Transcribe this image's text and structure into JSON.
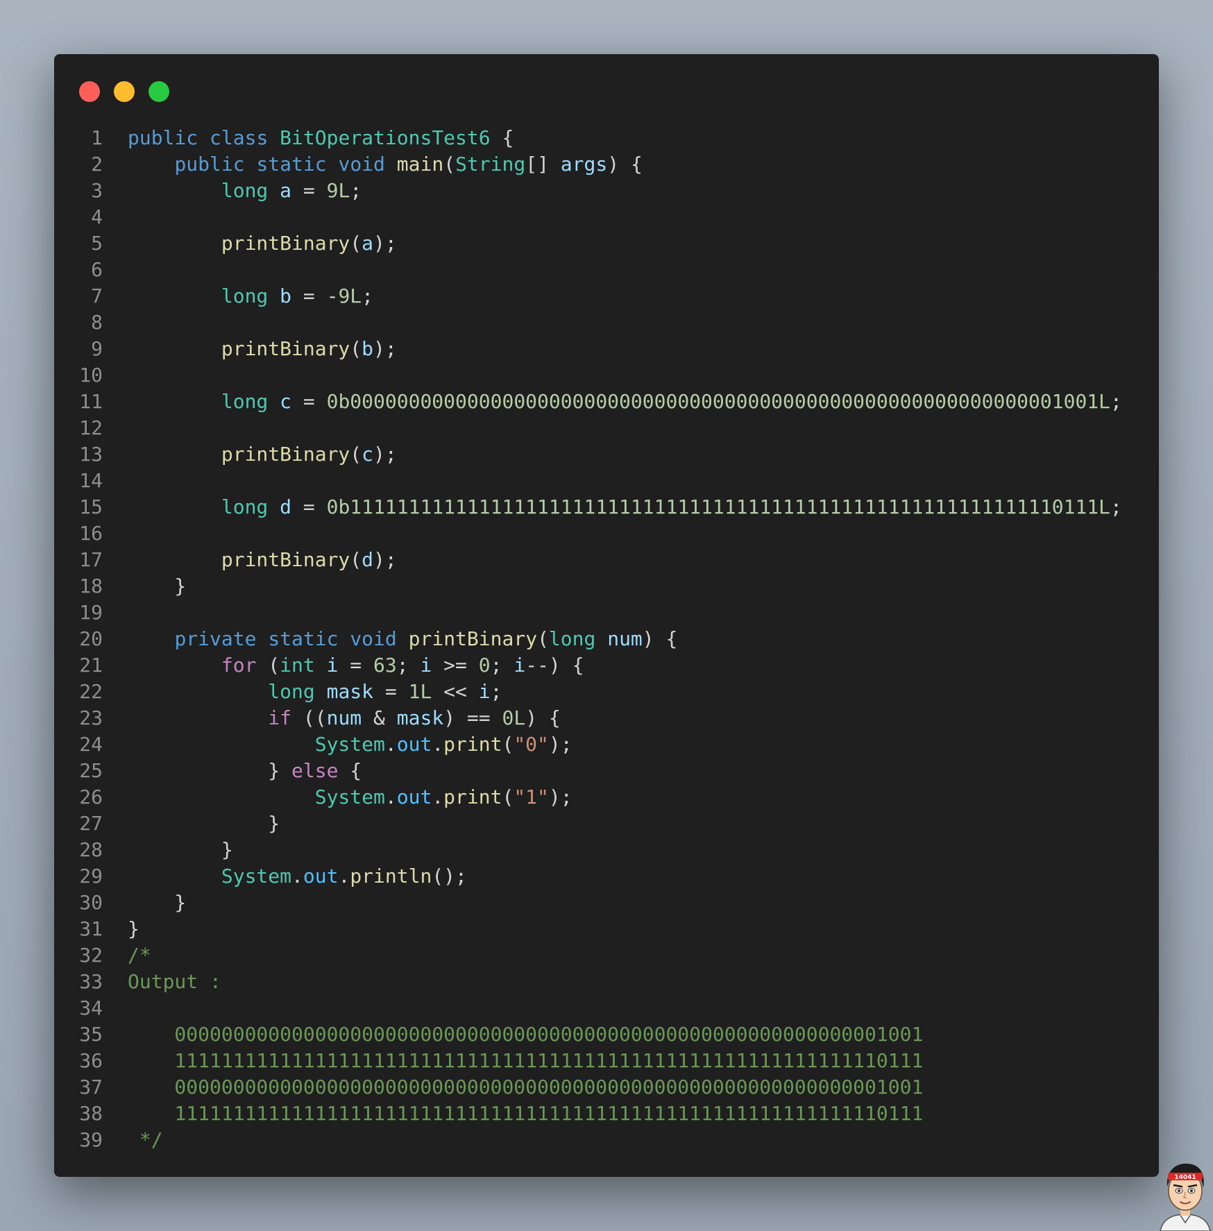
{
  "window": {
    "controls": [
      "close",
      "minimize",
      "maximize"
    ],
    "language": "java"
  },
  "code_lines": [
    {
      "n": "1",
      "tokens": [
        [
          "kw",
          "public"
        ],
        [
          "p",
          " "
        ],
        [
          "kw",
          "class"
        ],
        [
          "p",
          " "
        ],
        [
          "ty",
          "BitOperationsTest6"
        ],
        [
          "p",
          " {"
        ]
      ]
    },
    {
      "n": "2",
      "tokens": [
        [
          "p",
          "    "
        ],
        [
          "kw",
          "public"
        ],
        [
          "p",
          " "
        ],
        [
          "kw",
          "static"
        ],
        [
          "p",
          " "
        ],
        [
          "kw",
          "void"
        ],
        [
          "p",
          " "
        ],
        [
          "fn",
          "main"
        ],
        [
          "p",
          "("
        ],
        [
          "ty",
          "String"
        ],
        [
          "p",
          "[] "
        ],
        [
          "var",
          "args"
        ],
        [
          "p",
          ") {"
        ]
      ]
    },
    {
      "n": "3",
      "tokens": [
        [
          "p",
          "        "
        ],
        [
          "ty",
          "long"
        ],
        [
          "p",
          " "
        ],
        [
          "var",
          "a"
        ],
        [
          "p",
          " = "
        ],
        [
          "num",
          "9L"
        ],
        [
          "p",
          ";"
        ]
      ]
    },
    {
      "n": "4",
      "tokens": []
    },
    {
      "n": "5",
      "tokens": [
        [
          "p",
          "        "
        ],
        [
          "fn",
          "printBinary"
        ],
        [
          "p",
          "("
        ],
        [
          "var",
          "a"
        ],
        [
          "p",
          ");"
        ]
      ]
    },
    {
      "n": "6",
      "tokens": []
    },
    {
      "n": "7",
      "tokens": [
        [
          "p",
          "        "
        ],
        [
          "ty",
          "long"
        ],
        [
          "p",
          " "
        ],
        [
          "var",
          "b"
        ],
        [
          "p",
          " = -"
        ],
        [
          "num",
          "9L"
        ],
        [
          "p",
          ";"
        ]
      ]
    },
    {
      "n": "8",
      "tokens": []
    },
    {
      "n": "9",
      "tokens": [
        [
          "p",
          "        "
        ],
        [
          "fn",
          "printBinary"
        ],
        [
          "p",
          "("
        ],
        [
          "var",
          "b"
        ],
        [
          "p",
          ");"
        ]
      ]
    },
    {
      "n": "10",
      "tokens": []
    },
    {
      "n": "11",
      "tokens": [
        [
          "p",
          "        "
        ],
        [
          "ty",
          "long"
        ],
        [
          "p",
          " "
        ],
        [
          "var",
          "c"
        ],
        [
          "p",
          " = "
        ],
        [
          "num",
          "0b0000000000000000000000000000000000000000000000000000000000001001L"
        ],
        [
          "p",
          ";"
        ]
      ]
    },
    {
      "n": "12",
      "tokens": []
    },
    {
      "n": "13",
      "tokens": [
        [
          "p",
          "        "
        ],
        [
          "fn",
          "printBinary"
        ],
        [
          "p",
          "("
        ],
        [
          "var",
          "c"
        ],
        [
          "p",
          ");"
        ]
      ]
    },
    {
      "n": "14",
      "tokens": []
    },
    {
      "n": "15",
      "tokens": [
        [
          "p",
          "        "
        ],
        [
          "ty",
          "long"
        ],
        [
          "p",
          " "
        ],
        [
          "var",
          "d"
        ],
        [
          "p",
          " = "
        ],
        [
          "num",
          "0b1111111111111111111111111111111111111111111111111111111111110111L"
        ],
        [
          "p",
          ";"
        ]
      ]
    },
    {
      "n": "16",
      "tokens": []
    },
    {
      "n": "17",
      "tokens": [
        [
          "p",
          "        "
        ],
        [
          "fn",
          "printBinary"
        ],
        [
          "p",
          "("
        ],
        [
          "var",
          "d"
        ],
        [
          "p",
          ");"
        ]
      ]
    },
    {
      "n": "18",
      "tokens": [
        [
          "p",
          "    }"
        ]
      ]
    },
    {
      "n": "19",
      "tokens": []
    },
    {
      "n": "20",
      "tokens": [
        [
          "p",
          "    "
        ],
        [
          "kw",
          "private"
        ],
        [
          "p",
          " "
        ],
        [
          "kw",
          "static"
        ],
        [
          "p",
          " "
        ],
        [
          "kw",
          "void"
        ],
        [
          "p",
          " "
        ],
        [
          "fn",
          "printBinary"
        ],
        [
          "p",
          "("
        ],
        [
          "ty",
          "long"
        ],
        [
          "p",
          " "
        ],
        [
          "var",
          "num"
        ],
        [
          "p",
          ") {"
        ]
      ]
    },
    {
      "n": "21",
      "tokens": [
        [
          "p",
          "        "
        ],
        [
          "ctl",
          "for"
        ],
        [
          "p",
          " ("
        ],
        [
          "ty",
          "int"
        ],
        [
          "p",
          " "
        ],
        [
          "var",
          "i"
        ],
        [
          "p",
          " = "
        ],
        [
          "num",
          "63"
        ],
        [
          "p",
          "; "
        ],
        [
          "var",
          "i"
        ],
        [
          "p",
          " >= "
        ],
        [
          "num",
          "0"
        ],
        [
          "p",
          "; "
        ],
        [
          "var",
          "i"
        ],
        [
          "p",
          "--) {"
        ]
      ]
    },
    {
      "n": "22",
      "tokens": [
        [
          "p",
          "            "
        ],
        [
          "ty",
          "long"
        ],
        [
          "p",
          " "
        ],
        [
          "var",
          "mask"
        ],
        [
          "p",
          " = "
        ],
        [
          "num",
          "1L"
        ],
        [
          "p",
          " << "
        ],
        [
          "var",
          "i"
        ],
        [
          "p",
          ";"
        ]
      ]
    },
    {
      "n": "23",
      "tokens": [
        [
          "p",
          "            "
        ],
        [
          "ctl",
          "if"
        ],
        [
          "p",
          " (("
        ],
        [
          "var",
          "num"
        ],
        [
          "p",
          " & "
        ],
        [
          "var",
          "mask"
        ],
        [
          "p",
          ") == "
        ],
        [
          "num",
          "0L"
        ],
        [
          "p",
          ") {"
        ]
      ]
    },
    {
      "n": "24",
      "tokens": [
        [
          "p",
          "                "
        ],
        [
          "ty",
          "System"
        ],
        [
          "p",
          "."
        ],
        [
          "fld",
          "out"
        ],
        [
          "p",
          "."
        ],
        [
          "fn",
          "print"
        ],
        [
          "p",
          "("
        ],
        [
          "str",
          "\"0\""
        ],
        [
          "p",
          ");"
        ]
      ]
    },
    {
      "n": "25",
      "tokens": [
        [
          "p",
          "            } "
        ],
        [
          "ctl",
          "else"
        ],
        [
          "p",
          " {"
        ]
      ]
    },
    {
      "n": "26",
      "tokens": [
        [
          "p",
          "                "
        ],
        [
          "ty",
          "System"
        ],
        [
          "p",
          "."
        ],
        [
          "fld",
          "out"
        ],
        [
          "p",
          "."
        ],
        [
          "fn",
          "print"
        ],
        [
          "p",
          "("
        ],
        [
          "str",
          "\"1\""
        ],
        [
          "p",
          ");"
        ]
      ]
    },
    {
      "n": "27",
      "tokens": [
        [
          "p",
          "            }"
        ]
      ]
    },
    {
      "n": "28",
      "tokens": [
        [
          "p",
          "        }"
        ]
      ]
    },
    {
      "n": "29",
      "tokens": [
        [
          "p",
          "        "
        ],
        [
          "ty",
          "System"
        ],
        [
          "p",
          "."
        ],
        [
          "fld",
          "out"
        ],
        [
          "p",
          "."
        ],
        [
          "fn",
          "println"
        ],
        [
          "p",
          "();"
        ]
      ]
    },
    {
      "n": "30",
      "tokens": [
        [
          "p",
          "    }"
        ]
      ]
    },
    {
      "n": "31",
      "tokens": [
        [
          "p",
          "}"
        ]
      ]
    },
    {
      "n": "32",
      "tokens": [
        [
          "cmt",
          "/*"
        ]
      ]
    },
    {
      "n": "33",
      "tokens": [
        [
          "cmt",
          "Output :"
        ]
      ]
    },
    {
      "n": "34",
      "tokens": []
    },
    {
      "n": "35",
      "tokens": [
        [
          "cmt",
          "    0000000000000000000000000000000000000000000000000000000000001001"
        ]
      ]
    },
    {
      "n": "36",
      "tokens": [
        [
          "cmt",
          "    1111111111111111111111111111111111111111111111111111111111110111"
        ]
      ]
    },
    {
      "n": "37",
      "tokens": [
        [
          "cmt",
          "    0000000000000000000000000000000000000000000000000000000000001001"
        ]
      ]
    },
    {
      "n": "38",
      "tokens": [
        [
          "cmt",
          "    1111111111111111111111111111111111111111111111111111111111110111"
        ]
      ]
    },
    {
      "n": "39",
      "tokens": [
        [
          "cmt",
          " */"
        ]
      ]
    }
  ],
  "watermark": {
    "badge_text": "14041"
  }
}
